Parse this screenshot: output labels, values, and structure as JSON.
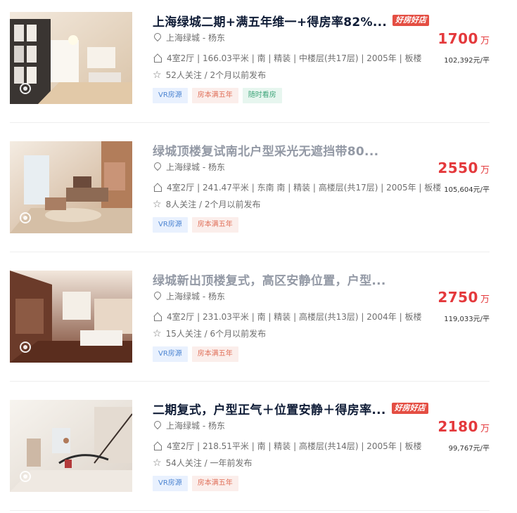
{
  "listings": [
    {
      "title": "上海绿城二期+满五年维一+得房率82%...",
      "badge": "好房好店",
      "location": "上海绿城 - 杨东",
      "info": "4室2厅 | 166.03平米 | 南 | 精装 | 中楼层(共17层) | 2005年 | 板楼",
      "follow": "52人关注 / 2个月以前发布",
      "tags": [
        "VR房源",
        "房本满五年",
        "随时看房"
      ],
      "price": "1700",
      "price_unit": "万",
      "unit_price": "102,392元/平"
    },
    {
      "title": "绿城顶楼复试南北户型采光无遮挡带80...",
      "badge": "",
      "location": "上海绿城 - 杨东",
      "info": "4室2厅 | 241.47平米 | 东南 南 | 精装 | 高楼层(共17层) | 2005年 | 板楼",
      "follow": "8人关注 / 2个月以前发布",
      "tags": [
        "VR房源",
        "房本满五年"
      ],
      "price": "2550",
      "price_unit": "万",
      "unit_price": "105,604元/平"
    },
    {
      "title": "绿城新出顶楼复式，高区安静位置，户型...",
      "badge": "",
      "location": "上海绿城 - 杨东",
      "info": "4室2厅 | 231.03平米 | 南 | 精装 | 高楼层(共13层) | 2004年 | 板楼",
      "follow": "15人关注 / 6个月以前发布",
      "tags": [
        "VR房源",
        "房本满五年"
      ],
      "price": "2750",
      "price_unit": "万",
      "unit_price": "119,033元/平"
    },
    {
      "title": "二期复式，户型正气＋位置安静＋得房率...",
      "badge": "好房好店",
      "location": "上海绿城 - 杨东",
      "info": "4室2厅 | 218.51平米 | 南 | 精装 | 高楼层(共14层) | 2005年 | 板楼",
      "follow": "54人关注 / 一年前发布",
      "tags": [
        "VR房源",
        "房本满五年"
      ],
      "price": "2180",
      "price_unit": "万",
      "unit_price": "99,767元/平"
    }
  ],
  "colors": {
    "price": "#e4393c",
    "title": "#101d37",
    "title_visited": "#9399a5"
  }
}
